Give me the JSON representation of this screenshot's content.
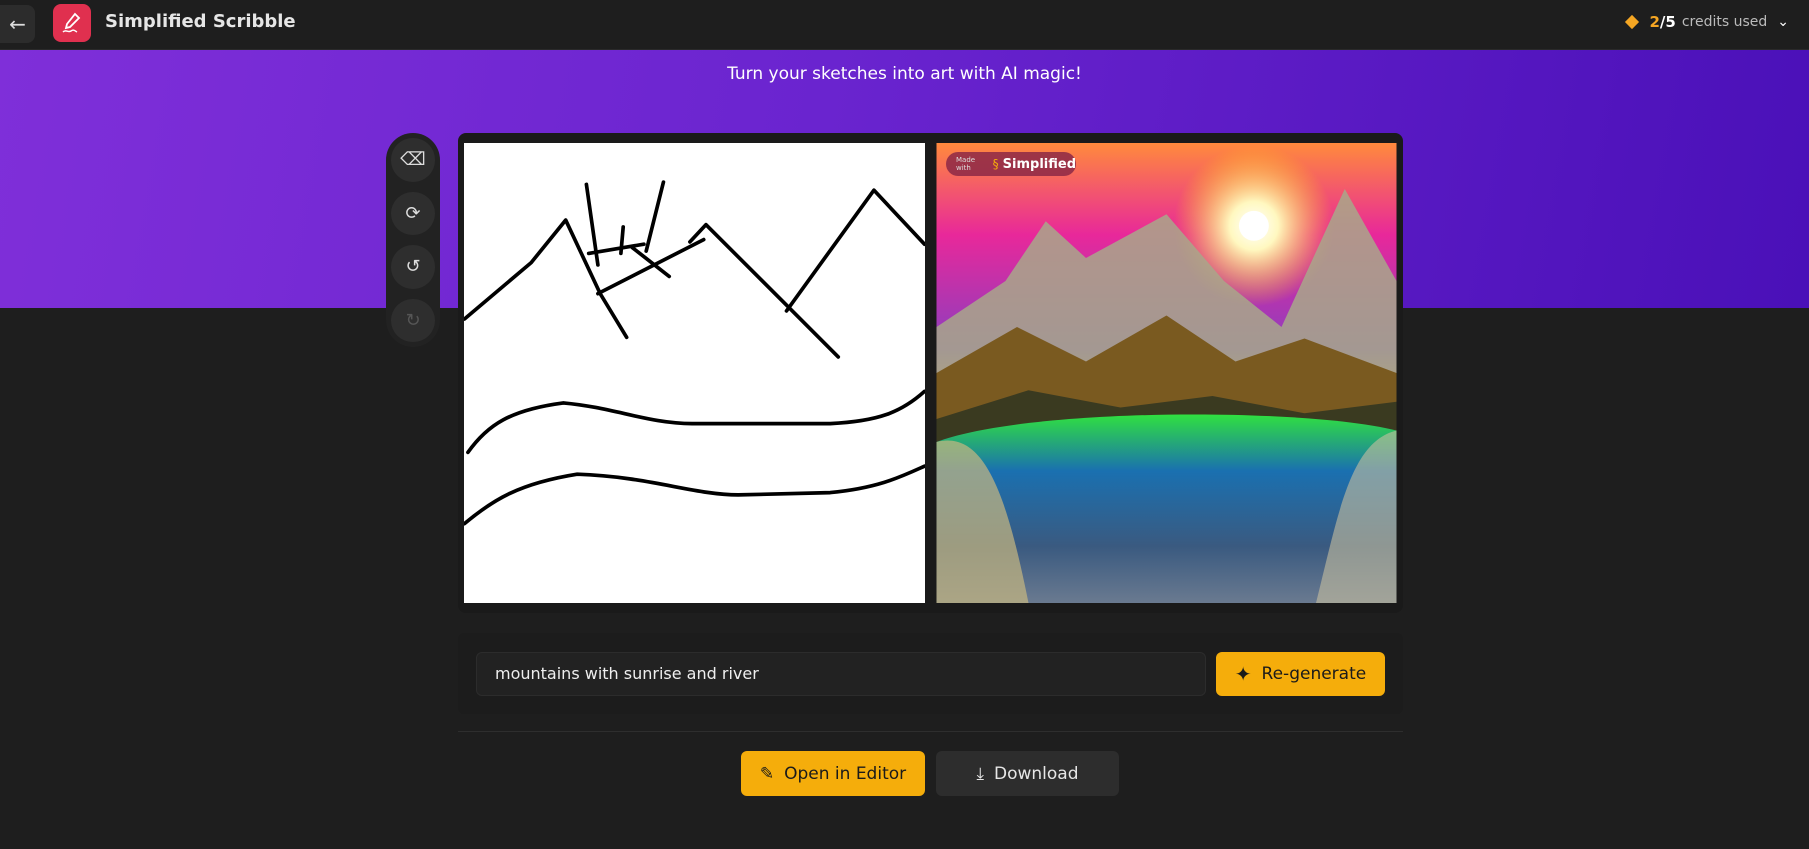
{
  "header": {
    "back_icon": "arrow-left-icon",
    "logo_icon": "pencil-scribble-icon",
    "title": "Simplified Scribble",
    "credits": {
      "used": "2",
      "separator": "/",
      "total": "5",
      "label": "credits used",
      "icon": "diamond-icon",
      "accent": "#f5a623"
    }
  },
  "banner": {
    "tagline": "Turn your sketches into art with AI magic!"
  },
  "tools": [
    {
      "name": "eraser",
      "icon": "eraser-icon"
    },
    {
      "name": "clear",
      "icon": "refresh-icon"
    },
    {
      "name": "undo",
      "icon": "undo-icon"
    },
    {
      "name": "redo",
      "icon": "redo-icon",
      "disabled": true
    }
  ],
  "result": {
    "watermark_small": "Made with",
    "watermark_brand": "Simplified"
  },
  "prompt": {
    "value": "mountains with sunrise and river",
    "regenerate_label": "Re-generate"
  },
  "actions": {
    "open_editor": "Open in Editor",
    "download": "Download"
  },
  "colors": {
    "accent": "#f5ad0b",
    "brand": "#e0304f",
    "banner": "#6a24cf"
  }
}
